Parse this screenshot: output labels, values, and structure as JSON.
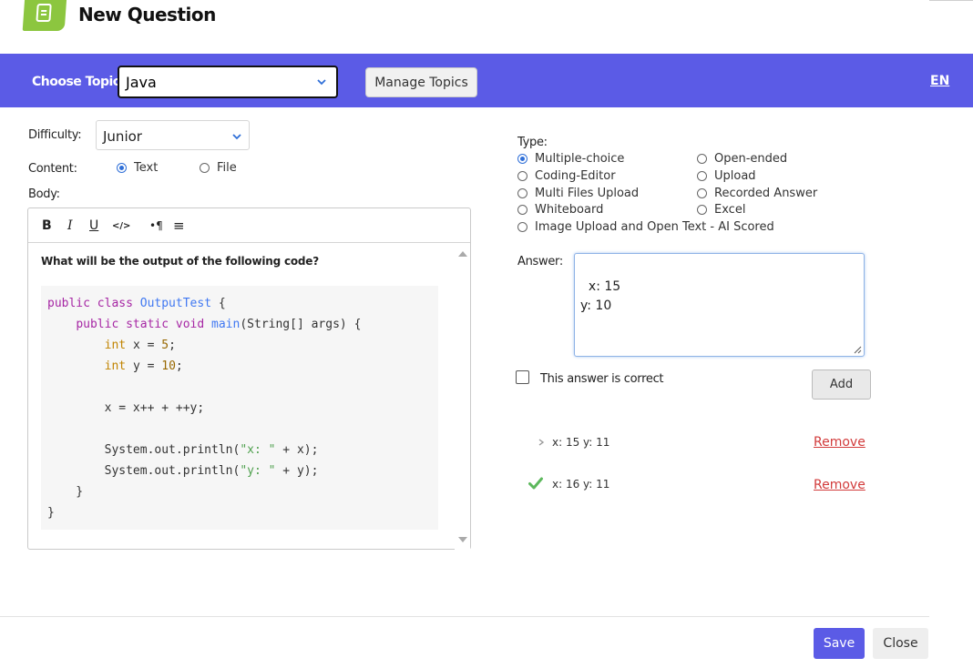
{
  "header": {
    "title": "New Question",
    "logo_icon": "document-icon"
  },
  "topic_bar": {
    "label": "Choose Topic:",
    "selected_topic": "Java",
    "manage_button": "Manage Topics",
    "language": "EN",
    "background_color": "#5b5be6"
  },
  "form": {
    "difficulty_label": "Difficulty:",
    "difficulty_value": "Junior",
    "content_label": "Content:",
    "content_options": [
      {
        "label": "Text",
        "selected": true
      },
      {
        "label": "File",
        "selected": false
      }
    ],
    "body_label": "Body:"
  },
  "editor": {
    "toolbar": [
      "B",
      "I",
      "U",
      "</>",
      "•¶",
      "≡"
    ],
    "question": "What will be the output of the following code?",
    "code_lines": [
      "public class OutputTest {",
      "    public static void main(String[] args) {",
      "        int x = 5;",
      "        int y = 10;",
      "",
      "        x = x++ + ++y;",
      "",
      "        System.out.println(\"x: \" + x);",
      "        System.out.println(\"y: \" + y);",
      "    }",
      "}"
    ]
  },
  "type": {
    "label": "Type:",
    "options": [
      {
        "label": "Multiple-choice",
        "selected": true
      },
      {
        "label": "Open-ended",
        "selected": false
      },
      {
        "label": "Coding-Editor",
        "selected": false
      },
      {
        "label": "Upload",
        "selected": false
      },
      {
        "label": "Multi Files Upload",
        "selected": false
      },
      {
        "label": "Recorded Answer",
        "selected": false
      },
      {
        "label": "Whiteboard",
        "selected": false
      },
      {
        "label": "Excel",
        "selected": false
      },
      {
        "label": "Image Upload and Open Text - AI Scored",
        "selected": false
      }
    ]
  },
  "answer": {
    "label": "Answer:",
    "value": "x: 15\ny: 10",
    "correct_checkbox_label": "This answer is correct",
    "add_button": "Add"
  },
  "answers_list": [
    {
      "text": "x: 15 y: 11",
      "correct": false,
      "remove_label": "Remove"
    },
    {
      "text": "x: 16 y: 11",
      "correct": true,
      "remove_label": "Remove"
    }
  ],
  "footer": {
    "save": "Save",
    "close": "Close"
  }
}
